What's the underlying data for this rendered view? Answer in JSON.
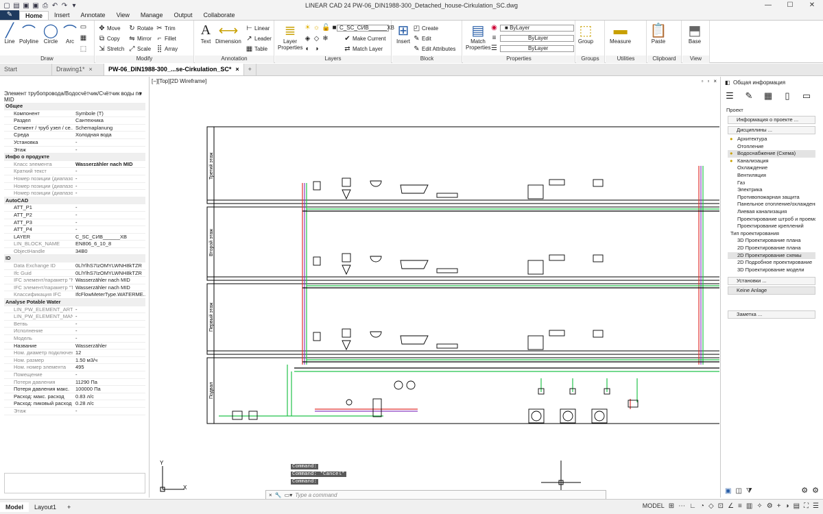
{
  "app": {
    "title": "LINEAR CAD 24   PW-06_DIN1988-300_Detached_house-Cirkulation_SC.dwg",
    "window_buttons": [
      "—",
      "☐",
      "✕"
    ]
  },
  "ribbon_tabs": [
    "Home",
    "Insert",
    "Annotate",
    "View",
    "Manage",
    "Output",
    "Collaborate"
  ],
  "ribbon": {
    "draw": {
      "label": "Draw",
      "line": "Line",
      "polyline": "Polyline",
      "circle": "Circle",
      "arc": "Arc"
    },
    "modify": {
      "label": "Modify",
      "move": "Move",
      "rotate": "Rotate",
      "trim": "Trim",
      "copy": "Copy",
      "mirror": "Mirror",
      "fillet": "Fillet",
      "stretch": "Stretch",
      "scale": "Scale",
      "array": "Array"
    },
    "annotation": {
      "label": "Annotation",
      "text": "Text",
      "dimension": "Dimension",
      "linear": "Linear",
      "leader": "Leader",
      "table": "Table"
    },
    "layers": {
      "label": "Layers",
      "layer_properties": "Layer Properties",
      "current_layer": "C_SC_СИВ______ХВ",
      "make_current": "Make Current",
      "match_layer": "Match Layer"
    },
    "block": {
      "label": "Block",
      "insert": "Insert",
      "create": "Create",
      "edit": "Edit",
      "edit_attributes": "Edit Attributes"
    },
    "properties": {
      "label": "Properties",
      "match_properties": "Match Properties",
      "color": "ByLayer",
      "linetype": "ByLayer",
      "lineweight": "ByLayer"
    },
    "groups": {
      "label": "Groups",
      "group": "Group"
    },
    "utilities": {
      "label": "Utilities",
      "measure": "Measure"
    },
    "clipboard": {
      "label": "Clipboard",
      "paste": "Paste"
    },
    "view": {
      "label": "View",
      "base": "Base"
    }
  },
  "doc_tabs": [
    "Start",
    "Drawing1*",
    "PW-06_DIN1988-300_...se-Cirkulation_SC*"
  ],
  "left_panel": {
    "header": "Элемент трубопровода/Водосчётчик/Счётчик воды по MID",
    "rows": [
      {
        "type": "sec",
        "k": "Общее"
      },
      {
        "k": "Компонент",
        "v": "Symbole (T)"
      },
      {
        "k": "Раздел",
        "v": "Сантехника"
      },
      {
        "k": "Сегмент / труб узел / се...",
        "v": "Schemaplanung"
      },
      {
        "k": "Среда",
        "v": "Холодная вода"
      },
      {
        "k": "Установка",
        "v": "-"
      },
      {
        "k": "Этаж",
        "v": "-"
      },
      {
        "type": "sec",
        "k": "Инфо о продукте"
      },
      {
        "k": "Класс элемента",
        "v": "Wasserzähler nach MID",
        "grey": true,
        "bold": true
      },
      {
        "k": "Краткий текст",
        "v": "-",
        "grey": true
      },
      {
        "k": "Номер позиции (диапазо...",
        "v": "-",
        "grey": true
      },
      {
        "k": "Номер позиции (диапазо...",
        "v": "-",
        "grey": true
      },
      {
        "k": "Номер позиции (диапазо...",
        "v": "-",
        "grey": true
      },
      {
        "type": "sec",
        "k": "AutoCAD"
      },
      {
        "k": "ATT_P1",
        "v": "-"
      },
      {
        "k": "ATT_P2",
        "v": "-"
      },
      {
        "k": "ATT_P3",
        "v": "-"
      },
      {
        "k": "ATT_P4",
        "v": "-"
      },
      {
        "k": "LAYER",
        "v": "C_SC_СИВ______ХВ"
      },
      {
        "k": "LIN_BLOCK_NAME",
        "v": "EN806_6_10_8",
        "grey": true
      },
      {
        "k": "ObjectHandle",
        "v": "34B0",
        "grey": true
      },
      {
        "type": "sec",
        "k": "ID"
      },
      {
        "k": "Data Exchange ID",
        "v": "0LlYlhS7IzOMYLWNH8kTZR",
        "grey": true
      },
      {
        "k": "Ifc Guid",
        "v": "0LlYlhS7IzOMYLWNH8kTZR",
        "grey": true
      },
      {
        "k": "IFC элемент/параметр \"N...",
        "v": "Wasserzähler nach MID",
        "grey": true
      },
      {
        "k": "IFC элемент/параметр \"T...",
        "v": "Wasserzähler nach MID",
        "grey": true
      },
      {
        "k": "Классификация IFC",
        "v": "IfcFlowMeterType.WATERME...",
        "grey": true
      },
      {
        "type": "sec",
        "k": "Analyse Potable Water"
      },
      {
        "k": "LIN_PW_ELEMENT_ARTI...",
        "v": "-",
        "grey": true
      },
      {
        "k": "LIN_PW_ELEMENT_MAN...",
        "v": "-",
        "grey": true
      },
      {
        "k": "Ветвь",
        "v": "-",
        "grey": true
      },
      {
        "k": "Исполнение",
        "v": "-",
        "grey": true
      },
      {
        "k": "Модель",
        "v": "-",
        "grey": true
      },
      {
        "k": "Название",
        "v": "Wasserzähler"
      },
      {
        "k": "Ном. диаметр подключен...",
        "v": "12",
        "grey": true
      },
      {
        "k": "Ном. размер",
        "v": "1.50 м3/ч",
        "grey": true
      },
      {
        "k": "Ном. номер элемента",
        "v": "495",
        "grey": true
      },
      {
        "k": "Помещение",
        "v": "-",
        "grey": true
      },
      {
        "k": "Потеря давления",
        "v": "11290 Па",
        "grey": true
      },
      {
        "k": "Потеря давления макс.",
        "v": "100000 Па"
      },
      {
        "k": "Расход: макс. расход",
        "v": "0.83 л/с"
      },
      {
        "k": "Расход: пиковый расход",
        "v": "0.28 л/с"
      },
      {
        "k": "Этаж",
        "v": "-",
        "grey": true
      }
    ]
  },
  "canvas": {
    "view_label": "[−][Top][2D Wireframe]",
    "floor_labels": [
      "Третий этаж",
      "Второй этаж",
      "Первый этаж",
      "Подвал"
    ],
    "commands": [
      "Command:",
      "Command: *Cancel*",
      "Command:"
    ],
    "command_placeholder": "Type a command",
    "ucs_x": "X",
    "ucs_y": "Y"
  },
  "right_panel": {
    "title": "Общая информация",
    "project_label": "Проект",
    "project_info": "Информация о проекте ...",
    "disciplines": "Дисциплины ...",
    "items": [
      {
        "t": "Архитектура",
        "marker": true
      },
      {
        "t": "Отопление"
      },
      {
        "t": "Водоснабжение (Схема)",
        "marker": true,
        "sel": true
      },
      {
        "t": "Канализация",
        "marker": true
      },
      {
        "t": "Охлаждение"
      },
      {
        "t": "Вентиляция"
      },
      {
        "t": "Газ"
      },
      {
        "t": "Электрика"
      },
      {
        "t": "Противопожарная защита"
      },
      {
        "t": "Панельное отопление/охлаждение"
      },
      {
        "t": "Лиевая канализация"
      },
      {
        "t": "Проектирование штроб и проемов"
      },
      {
        "t": "Проектирование креплений"
      },
      {
        "t": "Тип проектирования",
        "sub": true
      },
      {
        "t": "3D Проектирование плана"
      },
      {
        "t": "2D Проектирование плана"
      },
      {
        "t": "2D Проектирование схемы",
        "sel": true
      },
      {
        "t": "2D Подробное проектирование"
      },
      {
        "t": "3D Проектирование модели"
      }
    ],
    "installations": "Установки ...",
    "installation_value": "Keine Anlage",
    "note": "Заметка ..."
  },
  "status": {
    "tabs": [
      "Model",
      "Layout1",
      "+"
    ],
    "model_label": "MODEL"
  },
  "colors": {
    "green": "#22c24a",
    "red": "#e03030",
    "purple": "#8a3cc0",
    "accent": "#1e3a5f"
  }
}
